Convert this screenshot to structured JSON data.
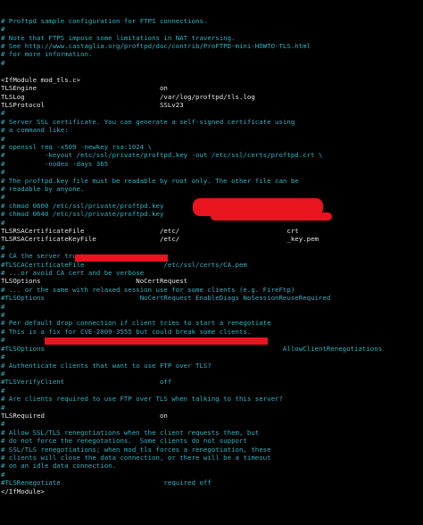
{
  "colors": {
    "background": "#000000",
    "comment": "#2fb3c2",
    "directive": "#e6e6e6",
    "redaction": "#e8141e"
  },
  "lines": [
    {
      "type": "comment",
      "text": "# Proftpd sample configuration for FTPS connections."
    },
    {
      "type": "comment",
      "text": "#"
    },
    {
      "type": "comment",
      "text": "# Note that FTPS impose some limitations in NAT traversing."
    },
    {
      "type": "comment",
      "text": "# See http://www.castaglia.org/proftpd/doc/contrib/ProFTPD-mini-HOWTO-TLS.html"
    },
    {
      "type": "comment",
      "text": "# for more information."
    },
    {
      "type": "comment",
      "text": "#"
    },
    {
      "type": "blank",
      "text": ""
    },
    {
      "type": "directive",
      "text": "<IfModule mod_tls.c>"
    },
    {
      "type": "directive",
      "text": "TLSEngine                               on"
    },
    {
      "type": "directive",
      "text": "TLSLog                                  /var/log/proftpd/tls.log"
    },
    {
      "type": "directive",
      "text": "TLSProtocol                             SSLv23"
    },
    {
      "type": "comment",
      "text": "#"
    },
    {
      "type": "comment",
      "text": "# Server SSL certificate. You can generate a self-signed certificate using"
    },
    {
      "type": "comment",
      "text": "# a command like:"
    },
    {
      "type": "comment",
      "text": "#"
    },
    {
      "type": "comment",
      "text": "# openssl req -x509 -newkey rsa:1024 \\"
    },
    {
      "type": "comment",
      "text": "#          -keyout /etc/ssl/private/proftpd.key -out /etc/ssl/certs/proftpd.crt \\"
    },
    {
      "type": "comment",
      "text": "#          -nodes -days 365"
    },
    {
      "type": "comment",
      "text": "#"
    },
    {
      "type": "comment",
      "text": "# The proftpd.key file must be readable by root only. The other file can be"
    },
    {
      "type": "comment",
      "text": "# readable by anyone."
    },
    {
      "type": "comment",
      "text": "#"
    },
    {
      "type": "comment",
      "text": "# chmod 0600 /etc/ssl/private/proftpd.key"
    },
    {
      "type": "comment",
      "text": "# chmod 0640 /etc/ssl/private/proftpd.key"
    },
    {
      "type": "comment",
      "text": "#"
    },
    {
      "type": "directive",
      "text": "TLSRSACertificateFile                   /etc/                           crt"
    },
    {
      "type": "directive",
      "text": "TLSRSACertificateKeyFile                /etc/                           _key.pem"
    },
    {
      "type": "comment",
      "text": "#"
    },
    {
      "type": "comment",
      "text": "# CA the server trusts..."
    },
    {
      "type": "comment",
      "text": "#TLSCACertificateFile                    /etc/ssl/certs/CA.pem"
    },
    {
      "type": "comment",
      "text": "# ...or avoid CA cert and be verbose"
    },
    {
      "type": "directive",
      "text": "TLSOptions                        NoCertRequest"
    },
    {
      "type": "comment",
      "text": "# ... or the same with relaxed session use for some clients (e.g. FireFtp)"
    },
    {
      "type": "comment",
      "text": "#TLSOptions                        NoCertRequest EnableDiags NoSessionReuseRequired"
    },
    {
      "type": "comment",
      "text": "#"
    },
    {
      "type": "comment",
      "text": "#"
    },
    {
      "type": "comment",
      "text": "# Per default drop connection if client tries to start a renegotiate"
    },
    {
      "type": "comment",
      "text": "# This is a fix for CVE-2009-3555 but could break some clients."
    },
    {
      "type": "comment",
      "text": "#"
    },
    {
      "type": "comment",
      "text": "#TLSOptions                                                            AllowClientRenegotiations"
    },
    {
      "type": "comment",
      "text": "#"
    },
    {
      "type": "comment",
      "text": "# Authenticate clients that want to use FTP over TLS?"
    },
    {
      "type": "comment",
      "text": "#"
    },
    {
      "type": "comment",
      "text": "#TLSVerifyClient                        off"
    },
    {
      "type": "comment",
      "text": "#"
    },
    {
      "type": "comment",
      "text": "# Are clients required to use FTP over TLS when talking to this server?"
    },
    {
      "type": "comment",
      "text": "#"
    },
    {
      "type": "directive",
      "text": "TLSRequired                             on"
    },
    {
      "type": "comment",
      "text": "#"
    },
    {
      "type": "comment",
      "text": "# Allow SSL/TLS renegotiations when the client requests them, but"
    },
    {
      "type": "comment",
      "text": "# do not force the renegotations.  Some clients do not support"
    },
    {
      "type": "comment",
      "text": "# SSL/TLS renegotiations; when mod_tls forces a renegotiation, these"
    },
    {
      "type": "comment",
      "text": "# clients will close the data connection, or there will be a timeout"
    },
    {
      "type": "comment",
      "text": "# on an idle data connection."
    },
    {
      "type": "comment",
      "text": "#"
    },
    {
      "type": "comment",
      "text": "#TLSRenegotiate                          required off"
    },
    {
      "type": "directive",
      "text": "</IfModule>"
    }
  ]
}
